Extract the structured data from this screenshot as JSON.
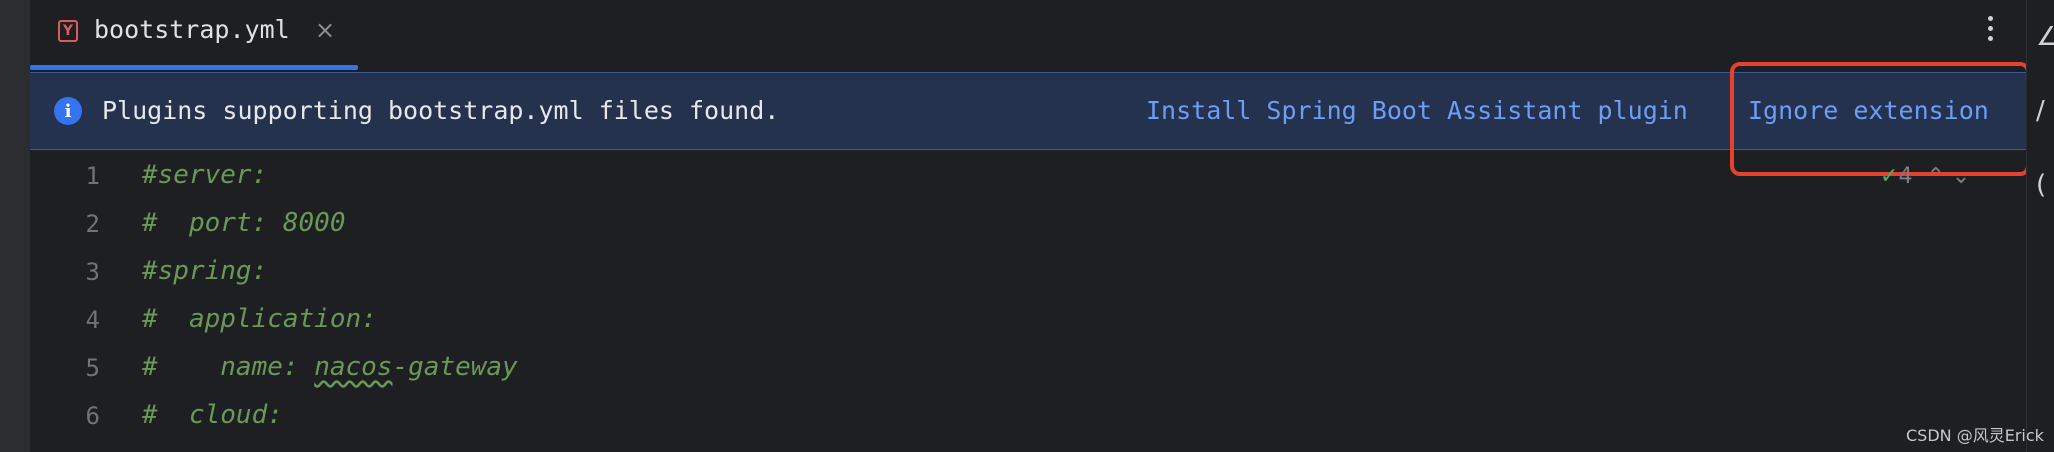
{
  "tab": {
    "icon": "yaml-file-icon",
    "icon_letter": "Y",
    "title": "bootstrap.yml",
    "close": "×"
  },
  "toolbar": {
    "more_icon": "more-vertical-icon"
  },
  "banner": {
    "icon": "info-icon",
    "message": "Plugins supporting bootstrap.yml files found.",
    "install_link": "Install Spring Boot Assistant plugin",
    "ignore_link": "Ignore extension"
  },
  "editor": {
    "line_numbers": [
      "1",
      "2",
      "3",
      "4",
      "5",
      "6"
    ],
    "lines": [
      "#server:",
      "#  port: 8000",
      "#spring:",
      "#  application:",
      "#    name: ",
      "#  cloud:"
    ],
    "line5_squiggle": "nacos",
    "line5_rest": "-gateway"
  },
  "inspection": {
    "check": "✓",
    "count": "4",
    "nav": "⌃ ⌄"
  },
  "right_panel": {
    "glyphs": [
      "∠",
      "/",
      "("
    ]
  },
  "watermark": "CSDN @风灵Erick",
  "colors": {
    "accent": "#3574f0",
    "link": "#6c9ef8",
    "comment": "#6a9955",
    "highlight": "#e8402e"
  }
}
